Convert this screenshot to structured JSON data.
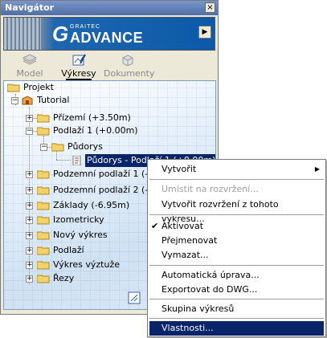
{
  "window": {
    "title": "Navigátor",
    "close_glyph": "×"
  },
  "banner": {
    "brand_sub": "GRAITEC",
    "brand_letter": "G",
    "brand_name": "ADVANCE",
    "arrow_glyph": "▶"
  },
  "tabs": [
    {
      "label": "Model",
      "icon": "model-icon",
      "active": false
    },
    {
      "label": "Výkresy",
      "icon": "drawings-icon",
      "active": true
    },
    {
      "label": "Dokumenty",
      "icon": "documents-icon",
      "active": false
    }
  ],
  "tree": {
    "items": [
      {
        "label": "Projekt",
        "expander": ""
      },
      {
        "label": "Tutorial",
        "expander": "−"
      },
      {
        "label": "Přízemí (+3.50m)",
        "expander": "+"
      },
      {
        "label": "Podlaží 1 (+0.00m)",
        "expander": "−"
      },
      {
        "label": "Půdorys",
        "expander": "−"
      },
      {
        "label": "Půdorys - Podlaží 1 (+0.00m)",
        "expander": ""
      },
      {
        "label": "Podzemní podlaží 1 (-0.9",
        "expander": "+"
      },
      {
        "label": "Podzemní podlaží 2 (-3.9",
        "expander": "+"
      },
      {
        "label": "Základy (-6.95m)",
        "expander": "+"
      },
      {
        "label": "Izometricky",
        "expander": "+"
      },
      {
        "label": "Nový výkres",
        "expander": "+"
      },
      {
        "label": "Podlaží",
        "expander": "+"
      },
      {
        "label": "Výkres výztuže",
        "expander": "+"
      },
      {
        "label": "Řezy",
        "expander": "+"
      }
    ]
  },
  "context_menu": {
    "items": [
      {
        "label": "Vytvořit",
        "state": "normal",
        "submenu": true,
        "submenu_glyph": "▶"
      },
      {
        "label": "Umístit na rozvržení...",
        "state": "disabled"
      },
      {
        "label": "Vytvořit rozvržení z tohoto výkresu...",
        "state": "normal"
      },
      {
        "label": "Aktivovat",
        "state": "checked",
        "check_glyph": "✔"
      },
      {
        "label": "Přejmenovat",
        "state": "normal"
      },
      {
        "label": "Vymazat...",
        "state": "normal"
      },
      {
        "label": "Automatická úprava...",
        "state": "normal"
      },
      {
        "label": "Exportovat do DWG...",
        "state": "normal"
      },
      {
        "label": "Skupina výkresů",
        "state": "normal"
      },
      {
        "label": "Vlastnosti...",
        "state": "highlight"
      }
    ]
  },
  "colors": {
    "highlight": "#0a246a",
    "titlebar": "#5a78b0",
    "folder": "#f2d26a",
    "brand_blue": "#0b5aa8"
  }
}
